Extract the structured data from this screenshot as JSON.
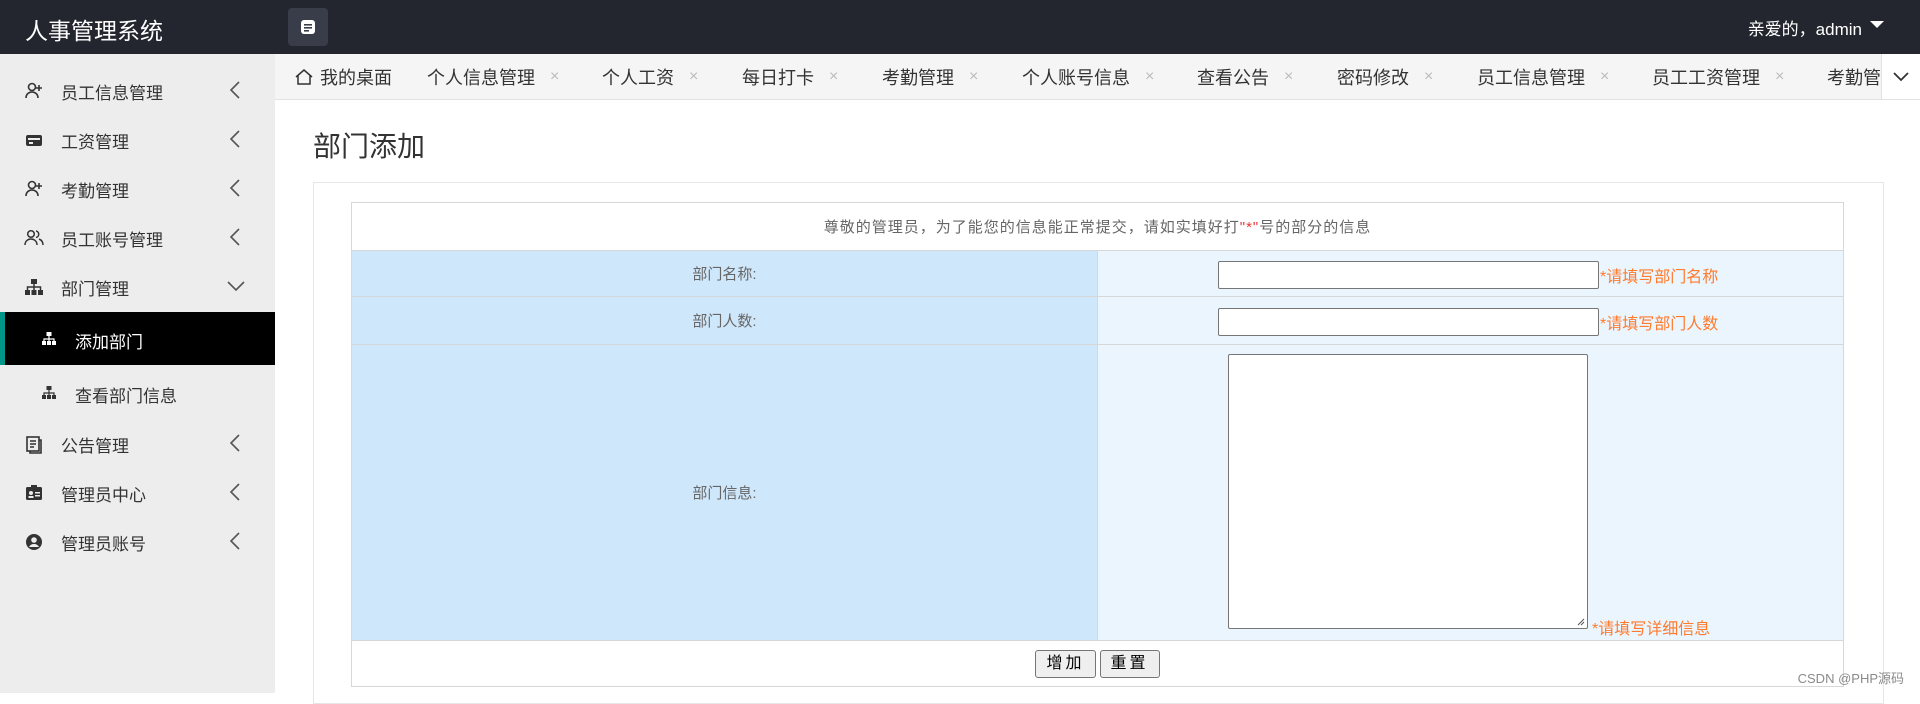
{
  "header": {
    "app_title": "人事管理系统",
    "user_greeting": "亲爱的，admin"
  },
  "sidebar": {
    "items": [
      {
        "label": "员工信息管理",
        "icon": "user-add-icon"
      },
      {
        "label": "工资管理",
        "icon": "wallet-icon"
      },
      {
        "label": "考勤管理",
        "icon": "user-add-icon"
      },
      {
        "label": "员工账号管理",
        "icon": "users-icon"
      },
      {
        "label": "部门管理",
        "icon": "sitemap-icon"
      },
      {
        "label": "添加部门",
        "icon": "sitemap-icon"
      },
      {
        "label": "查看部门信息",
        "icon": "sitemap-icon"
      },
      {
        "label": "公告管理",
        "icon": "document-icon"
      },
      {
        "label": "管理员中心",
        "icon": "id-card-icon"
      },
      {
        "label": "管理员账号",
        "icon": "user-circle-icon"
      }
    ]
  },
  "tabs": [
    {
      "label": "我的桌面"
    },
    {
      "label": "个人信息管理"
    },
    {
      "label": "个人工资"
    },
    {
      "label": "每日打卡"
    },
    {
      "label": "考勤管理"
    },
    {
      "label": "个人账号信息"
    },
    {
      "label": "查看公告"
    },
    {
      "label": "密码修改"
    },
    {
      "label": "员工信息管理"
    },
    {
      "label": "员工工资管理"
    },
    {
      "label": "考勤管"
    }
  ],
  "tab_close_glyph": "×",
  "main": {
    "page_title": "部门添加",
    "notice_prefix": "尊敬的管理员，为了能您的信息能正常提交，请如实填好打",
    "notice_star": "\"*\"",
    "notice_suffix": "号的部分的信息",
    "fields": {
      "name_label": "部门名称:",
      "name_value": "",
      "name_hint": "*请填写部门名称",
      "count_label": "部门人数:",
      "count_value": "",
      "count_hint": "*请填写部门人数",
      "info_label": "部门信息:",
      "info_value": "",
      "info_hint": "*请填写详细信息"
    },
    "buttons": {
      "add": "增加",
      "reset": "重置"
    }
  },
  "watermark": "CSDN @PHP源码",
  "colors": {
    "topbar": "#23262e",
    "sidebar_bg": "#ededed",
    "active_item": "#000000",
    "active_accent": "#009688",
    "label_cell": "#cfe7fb",
    "value_cell": "#eaf5fe",
    "hint": "#ff7b2e"
  }
}
